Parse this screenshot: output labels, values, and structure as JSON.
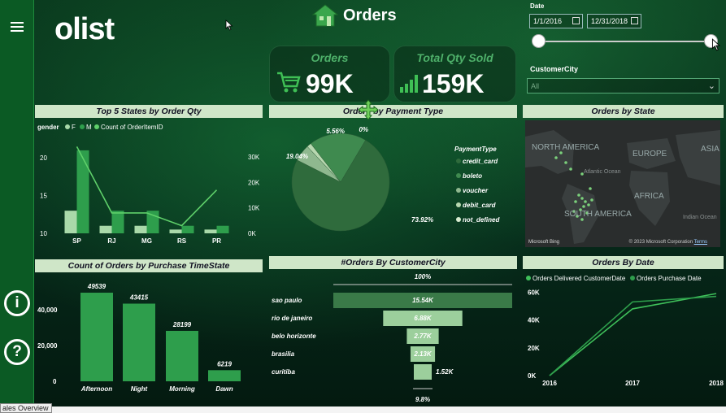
{
  "app": {
    "logo": "olist",
    "title": "Orders",
    "bottom_tab": "ales Overview"
  },
  "kpis": [
    {
      "label": "Orders",
      "value": "99K"
    },
    {
      "label": "Total Qty Sold",
      "value": "159K"
    }
  ],
  "filters": {
    "date_label": "Date",
    "date_start": "1/1/2016",
    "date_end": "12/31/2018",
    "city_label": "CustomerCity",
    "city_value": "All"
  },
  "colors": {
    "accent": "#2e9e4c",
    "bar_light": "#a9d9a9",
    "bar_dark": "#2e9e4c",
    "line": "#5fd06a"
  },
  "chart_data": [
    {
      "type": "bar",
      "title": "Top 5 States by Order Qty",
      "legend_title": "gender",
      "legend": [
        "F",
        "M",
        "Count of OrderItemID"
      ],
      "categories": [
        "SP",
        "RJ",
        "MG",
        "RS",
        "PR"
      ],
      "series": [
        {
          "name": "F",
          "values": [
            13,
            11,
            11,
            10.5,
            10.5
          ]
        },
        {
          "name": "M",
          "values": [
            21,
            13,
            13,
            11,
            11
          ]
        },
        {
          "name": "Count of OrderItemID",
          "values": [
            34000,
            8000,
            8000,
            3000,
            17000
          ]
        }
      ],
      "y_ticks": [
        "10",
        "15",
        "20"
      ],
      "y2_ticks": [
        "0K",
        "10K",
        "20K",
        "30K"
      ],
      "ylim": [
        10,
        22.5
      ],
      "y2lim": [
        0,
        37000
      ]
    },
    {
      "type": "pie",
      "title": "Orders by Payment Type",
      "legend_title": "PaymentType",
      "categories": [
        "credit_card",
        "boleto",
        "voucher",
        "debit_card",
        "not_defined"
      ],
      "values": [
        73.92,
        19.04,
        5.56,
        1.48,
        0.0
      ],
      "data_labels": [
        "73.92%",
        "19.04%",
        "5.56%",
        "0%"
      ]
    },
    {
      "type": "bar",
      "title": "Count of Orders by Purchase TimeState",
      "categories": [
        "Afternoon",
        "Night",
        "Morning",
        "Dawn"
      ],
      "values": [
        49539,
        43415,
        28199,
        6219
      ],
      "data_labels": [
        "49539",
        "43415",
        "28199",
        "6219"
      ],
      "y_ticks": [
        "0",
        "20,000",
        "40,000"
      ],
      "ylim": [
        0,
        55000
      ]
    },
    {
      "type": "bar",
      "title": "#Orders By CustomerCity",
      "top_label": "100%",
      "bottom_label": "9.8%",
      "categories": [
        "sao paulo",
        "rio de janeiro",
        "belo horizonte",
        "brasilia",
        "curitiba"
      ],
      "values": [
        15540,
        6880,
        2770,
        2130,
        1520
      ],
      "data_labels": [
        "15.54K",
        "6.88K",
        "2.77K",
        "2.13K",
        "1.52K"
      ]
    },
    {
      "type": "line",
      "title": "Orders By Date",
      "legend": [
        "Orders Delivered CustomerDate",
        "Orders Purchase Date"
      ],
      "x": [
        "2016",
        "2017",
        "2018"
      ],
      "series": [
        {
          "name": "Orders Delivered CustomerDate",
          "values": [
            0,
            48000,
            59000
          ]
        },
        {
          "name": "Orders Purchase Date",
          "values": [
            0,
            53000,
            57000
          ]
        }
      ],
      "y_ticks": [
        "0K",
        "20K",
        "40K",
        "60K"
      ],
      "ylim": [
        0,
        62000
      ]
    }
  ],
  "map": {
    "title": "Orders by State",
    "labels": [
      "NORTH AMERICA",
      "EUROPE",
      "ASIA",
      "AFRICA",
      "SOUTH AMERICA"
    ],
    "small_labels": [
      "Atlantic Ocean",
      "Indian Ocean"
    ],
    "attribution": "© 2023 Microsoft Corporation",
    "terms": "Terms",
    "provider": "Microsoft Bing"
  }
}
